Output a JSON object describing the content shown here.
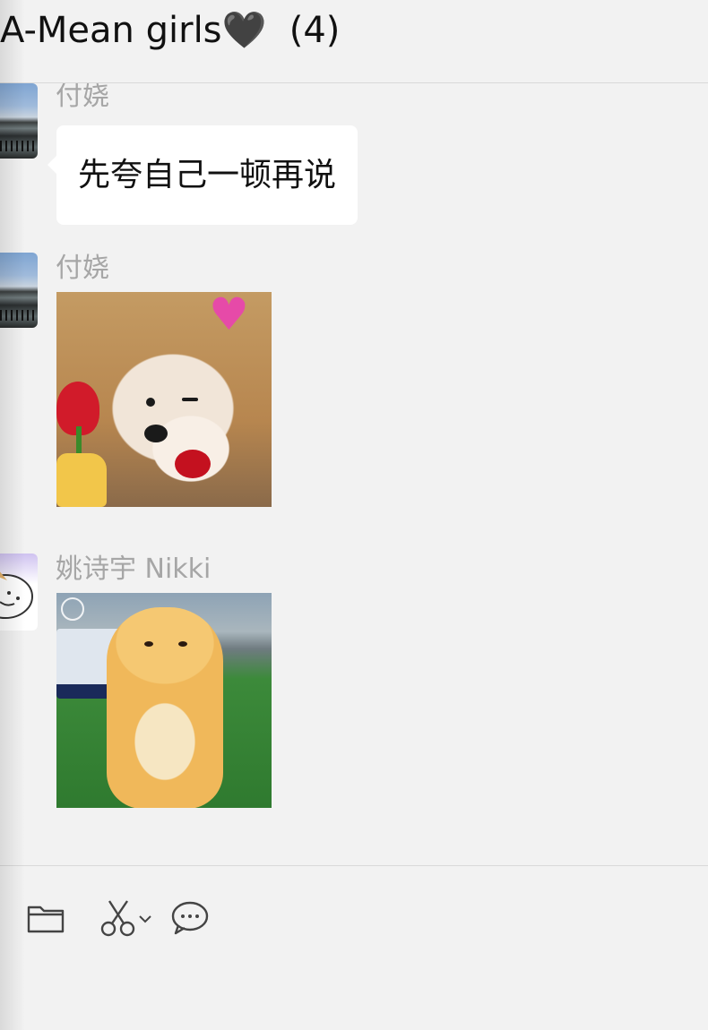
{
  "header": {
    "title": "A-Mean girls🖤  (4)"
  },
  "messages": [
    {
      "sender": "付娆",
      "type": "text",
      "text": "先夸自己一顿再说"
    },
    {
      "sender": "付娆",
      "type": "sticker",
      "sticker": "puppy-with-roses"
    },
    {
      "sender": "姚诗宇 Nikki",
      "type": "sticker",
      "sticker": "yellow-creature"
    }
  ],
  "toolbar": {
    "icons": [
      "folder-icon",
      "scissors-icon",
      "chevron-down-icon",
      "chat-bubble-icon"
    ]
  },
  "colors": {
    "background": "#f2f2f2",
    "bubble": "#ffffff",
    "sender_name": "#a6a6a6",
    "divider": "#d9d9d9"
  }
}
